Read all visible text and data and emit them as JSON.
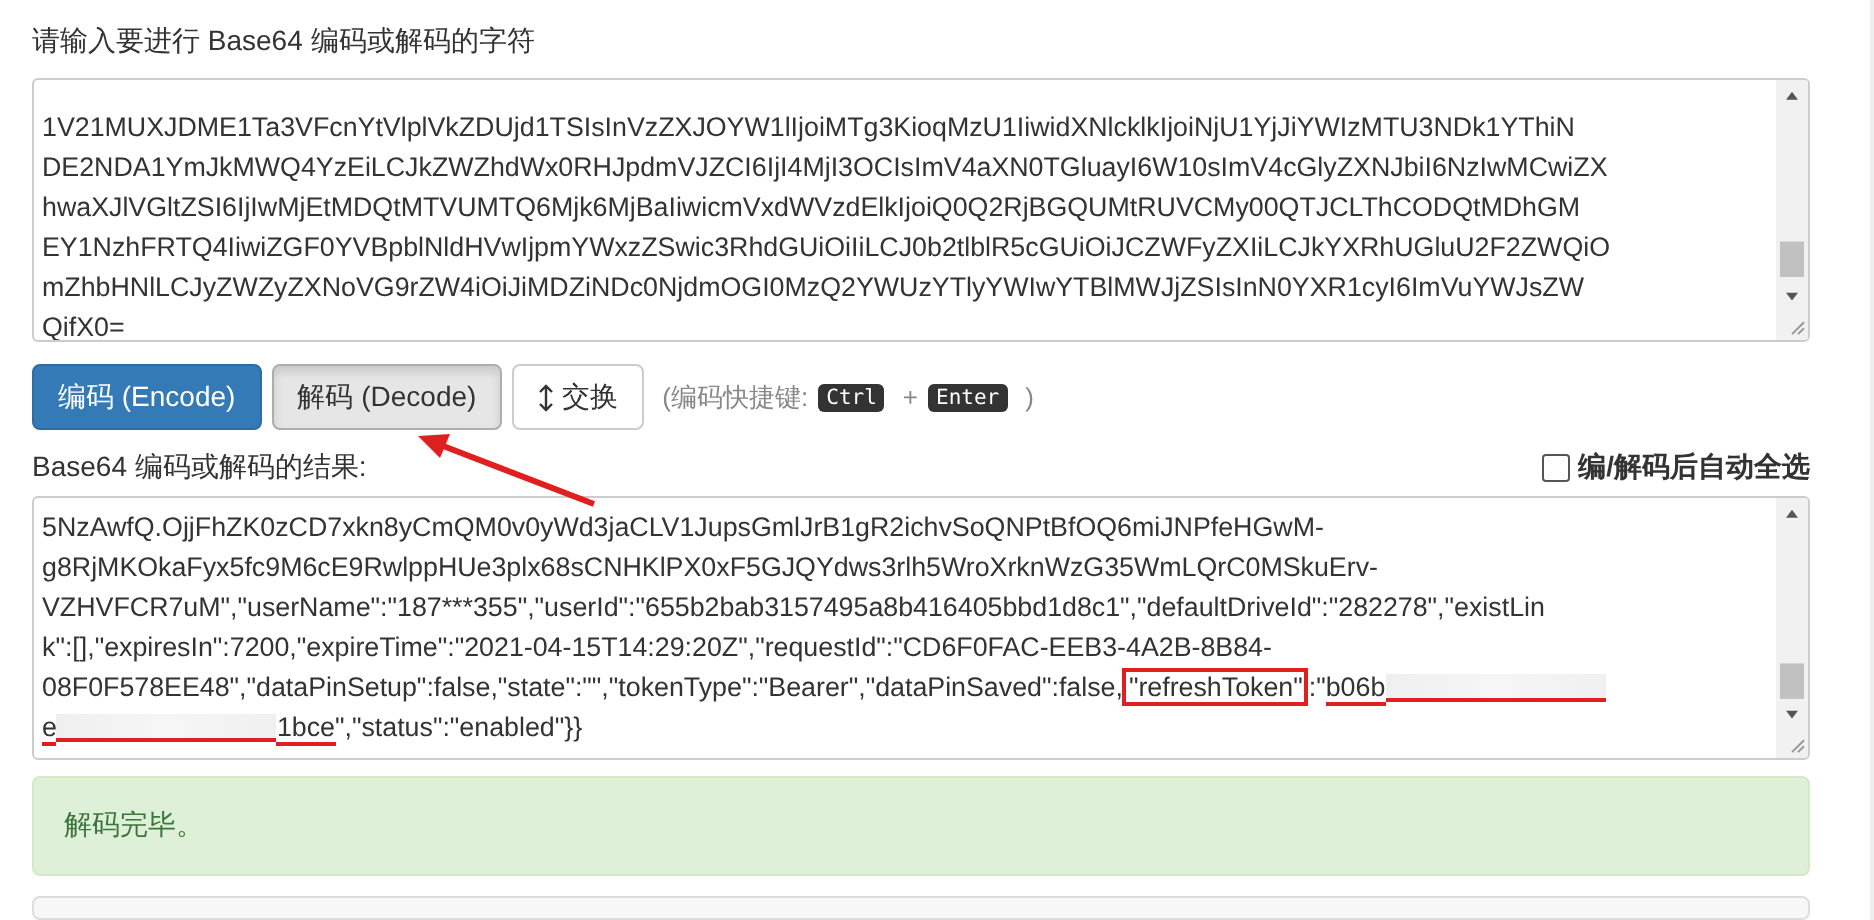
{
  "input": {
    "label": "请输入要进行 Base64 编码或解码的字符",
    "lines": [
      "1V21MUXJDME1Ta3VFcnYtVlplVkZDUjd1TSIsInVzZXJOYW1lIjoiMTg3KioqMzU1IiwidXNlcklkIjoiNjU1YjJiYWIzMTU3NDk1YThiN",
      "DE2NDA1YmJkMWQ4YzEiLCJkZWZhdWx0RHJpdmVJZCI6IjI4MjI3OCIsImV4aXN0TGluayI6W10sImV4cGlyZXNJbiI6NzIwMCwiZX",
      "hwaXJlVGltZSI6IjIwMjEtMDQtMTVUMTQ6Mjk6MjBaIiwicmVxdWVzdElkIjoiQ0Q2RjBGQUMtRUVCMy00QTJCLThCODQtMDhGM",
      "EY1NzhFRTQ4IiwiZGF0YVBpblNldHVwIjpmYWxzZSwic3RhdGUiOiIiLCJ0b2tlblR5cGUiOiJCZWFyZXIiLCJkYXRhUGluU2F2ZWQiO",
      "mZhbHNlLCJyZWZyZXNoVG9rZW4iOiJiMDZiNDc0NjdmOGI0MzQ2YWUzYTlyYWIwYTBlMWJjZSIsInN0YXR1cyI6ImVuYWJsZW",
      "QifX0="
    ]
  },
  "buttons": [
    {
      "kind": "primary",
      "label": "编码 (Encode)",
      "active": false
    },
    {
      "kind": "default",
      "label": "解码 (Decode)",
      "active": true
    },
    {
      "kind": "swap",
      "label": "交换",
      "active": false
    }
  ],
  "shortcut": {
    "open": "(编码快捷键:",
    "keys": [
      "Ctrl",
      "Enter"
    ],
    "plus": "+",
    "close": ")"
  },
  "result": {
    "label": "Base64 编码或解码的结果:",
    "auto_select": {
      "label": "编/解码后自动全选",
      "checked": false
    },
    "lines": [
      [
        {
          "kind": "text",
          "text": "5NzAwfQ.OjjFhZK0zCD7xkn8yCmQM0v0yWd3jaCLV1JupsGmlJrB1gR2ichvSoQNPtBfOQ6miJNPfeHGwM-"
        }
      ],
      [
        {
          "kind": "text",
          "text": "g8RjMKOkaFyx5fc9M6cE9RwlppHUe3plx68sCNHKlPX0xF5GJQYdws3rlh5WroXrknWzG35WmLQrC0MSkuErv-"
        }
      ],
      [
        {
          "kind": "text",
          "text": "VZHVFCR7uM\",\"userName\":\"187***355\",\"userId\":\"655b2bab3157495a8b416405bbd1d8c1\",\"defaultDriveId\":\"282278\",\"existLin"
        }
      ],
      [
        {
          "kind": "text",
          "text": "k\":[],\"expiresIn\":7200,\"expireTime\":\"2021-04-15T14:29:20Z\",\"requestId\":\"CD6F0FAC-EEB3-4A2B-8B84-"
        }
      ],
      [
        {
          "kind": "text",
          "text": "08F0F578EE48\",\"dataPinSetup\":false,\"state\":\"\",\"tokenType\":\"Bearer\",\"dataPinSaved\":false,"
        },
        {
          "kind": "boxed",
          "text": "\"refreshToken\""
        },
        {
          "kind": "text",
          "text": ":\""
        },
        {
          "kind": "underlined",
          "text": "b06b"
        },
        {
          "kind": "redacted"
        }
      ],
      [
        {
          "kind": "underlined",
          "text": "e"
        },
        {
          "kind": "redacted"
        },
        {
          "kind": "underlined",
          "text": "1bce"
        },
        {
          "kind": "text",
          "text": "\",\"status\":\"enabled\"}}"
        }
      ]
    ]
  },
  "status": {
    "text": "解码完毕。"
  }
}
